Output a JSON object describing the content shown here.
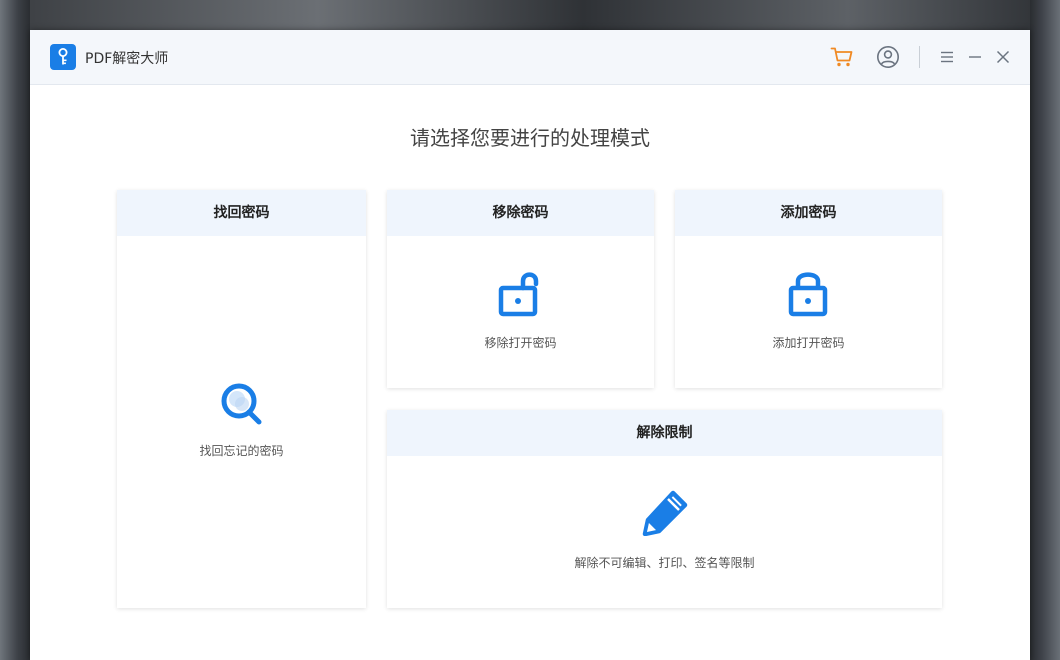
{
  "app": {
    "title": "PDF解密大师"
  },
  "titlebar": {
    "cart_icon": "cart-icon",
    "account_icon": "user-icon",
    "menu_icon": "menu-icon",
    "minimize_icon": "minimize-icon",
    "close_icon": "close-icon"
  },
  "main": {
    "heading": "请选择您要进行的处理模式"
  },
  "cards": {
    "recover": {
      "title": "找回密码",
      "desc": "找回忘记的密码",
      "icon": "search-icon"
    },
    "remove": {
      "title": "移除密码",
      "desc": "移除打开密码",
      "icon": "unlock-icon"
    },
    "add": {
      "title": "添加密码",
      "desc": "添加打开密码",
      "icon": "lock-icon"
    },
    "unrestrict": {
      "title": "解除限制",
      "desc": "解除不可编辑、打印、签名等限制",
      "icon": "pencil-icon"
    }
  },
  "colors": {
    "accent": "#1a7ee6",
    "cart": "#f08a24",
    "card_header": "#eff5fd"
  }
}
